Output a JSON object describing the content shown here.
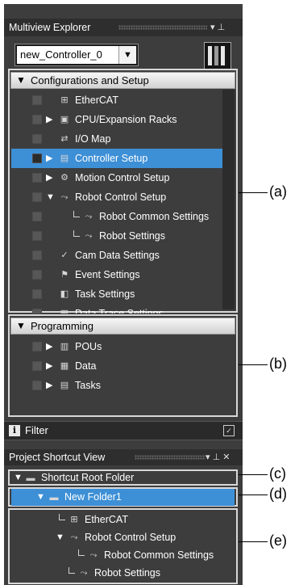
{
  "multiview": {
    "title": "Multiview Explorer",
    "pin_glyph": "▾ ⊥",
    "controller_name": "new_Controller_0",
    "dropdown_glyph": "▼"
  },
  "config": {
    "header": "Configurations and Setup",
    "collapse_glyph": "▼",
    "items": [
      {
        "label": "EtherCAT",
        "icon": "ethercat-icon",
        "glyph": "⊞",
        "expander": ""
      },
      {
        "label": "CPU/Expansion Racks",
        "icon": "rack-icon",
        "glyph": "▣",
        "expander": "▶"
      },
      {
        "label": "I/O Map",
        "icon": "io-map-icon",
        "glyph": "⇄",
        "expander": ""
      },
      {
        "label": "Controller Setup",
        "icon": "controller-setup-icon",
        "glyph": "▤",
        "expander": "▶"
      },
      {
        "label": "Motion Control Setup",
        "icon": "gear-icon",
        "glyph": "⚙",
        "expander": "▶"
      },
      {
        "label": "Robot Control Setup",
        "icon": "robot-icon",
        "glyph": "⤳",
        "expander": "▼"
      },
      {
        "label": "Robot Common Settings",
        "icon": "robot-common-icon",
        "glyph": "⤳",
        "expander": ""
      },
      {
        "label": "Robot Settings",
        "icon": "robot-settings-icon",
        "glyph": "⤳",
        "expander": ""
      },
      {
        "label": "Cam Data Settings",
        "icon": "cam-icon",
        "glyph": "✓",
        "expander": ""
      },
      {
        "label": "Event Settings",
        "icon": "flag-icon",
        "glyph": "⚑",
        "expander": ""
      },
      {
        "label": "Task Settings",
        "icon": "task-icon",
        "glyph": "◧",
        "expander": ""
      },
      {
        "label": "Data Trace Settings",
        "icon": "trace-icon",
        "glyph": "▦",
        "expander": ""
      }
    ]
  },
  "programming": {
    "header": "Programming",
    "collapse_glyph": "▼",
    "items": [
      {
        "label": "POUs",
        "icon": "pou-icon",
        "glyph": "▥",
        "expander": "▶"
      },
      {
        "label": "Data",
        "icon": "data-icon",
        "glyph": "▦",
        "expander": "▶"
      },
      {
        "label": "Tasks",
        "icon": "tasks-icon",
        "glyph": "▤",
        "expander": "▶"
      }
    ]
  },
  "filter": {
    "label": "Filter",
    "icon_glyph": "i",
    "pin_glyph": "✓"
  },
  "shortcut": {
    "title": "Project Shortcut View",
    "controls": "▾ ⊥ ✕",
    "root": "Shortcut Root Folder",
    "folder": "New Folder1",
    "items": [
      {
        "label": "EtherCAT",
        "icon": "ethercat-icon",
        "glyph": "⊞",
        "expander": ""
      },
      {
        "label": "Robot Control Setup",
        "icon": "robot-icon",
        "glyph": "⤳",
        "expander": "▼"
      },
      {
        "label": "Robot Common Settings",
        "icon": "robot-common-icon",
        "glyph": "⤳",
        "expander": ""
      },
      {
        "label": "Robot Settings",
        "icon": "robot-settings-icon",
        "glyph": "⤳",
        "expander": ""
      }
    ],
    "expand_glyph": "▼",
    "folder_glyph": "▬"
  },
  "callouts": {
    "a": "(a)",
    "b": "(b)",
    "c": "(c)",
    "d": "(d)",
    "e": "(e)"
  },
  "colors": {
    "panel_bg": "#3d3d3d",
    "selection": "#3d8fd6",
    "box_border": "#d8d8d8"
  }
}
